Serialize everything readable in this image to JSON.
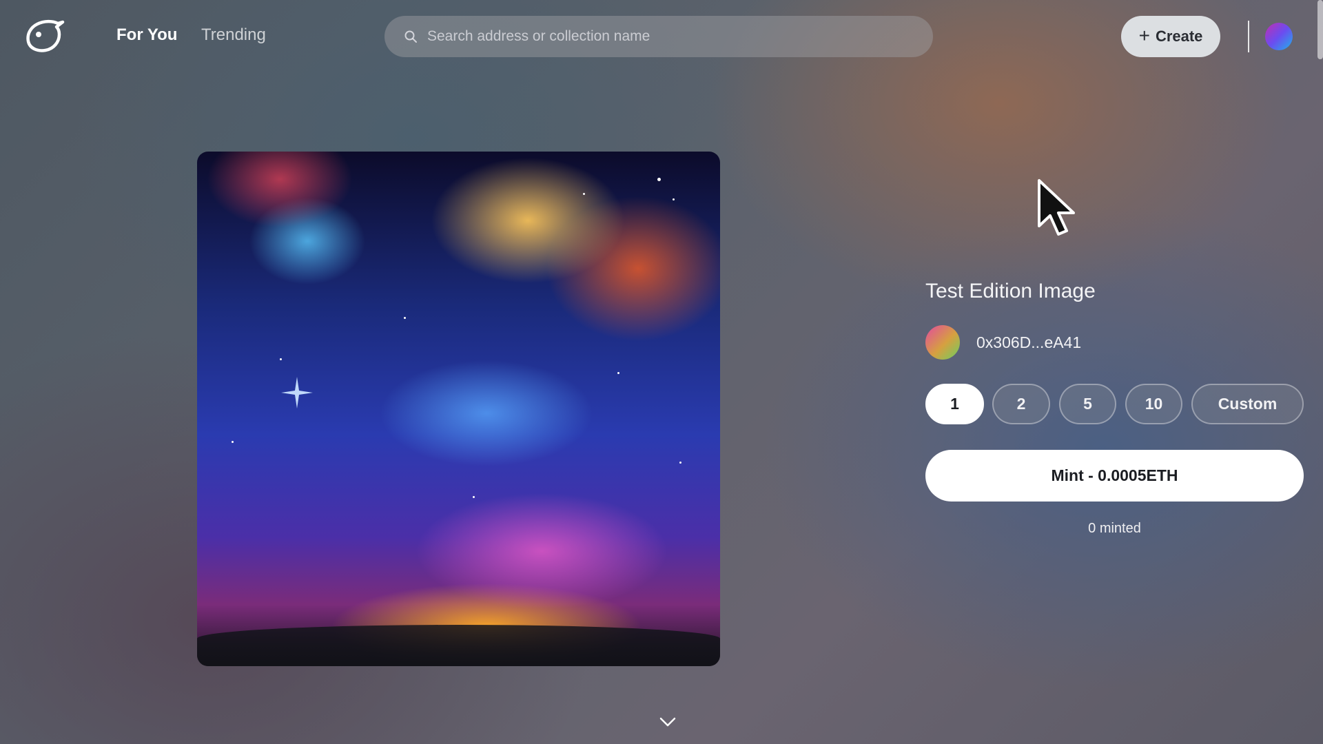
{
  "header": {
    "nav": {
      "for_you": "For You",
      "trending": "Trending"
    },
    "search": {
      "placeholder": "Search address or collection name",
      "value": ""
    },
    "create_label": "Create"
  },
  "edition": {
    "title": "Test Edition Image",
    "creator_address": "0x306D...eA41",
    "quantity_options": [
      "1",
      "2",
      "5",
      "10",
      "Custom"
    ],
    "selected_quantity": "1",
    "mint_label": "Mint - 0.0005ETH",
    "minted_status": "0 minted"
  },
  "icons": {
    "logo": "bird-logo-icon",
    "search": "search-icon",
    "create": "plus-icon",
    "scroll": "chevron-down-icon",
    "cursor": "mouse-pointer-icon"
  },
  "colors": {
    "mint_button_bg": "#ffffff",
    "selected_quantity_bg": "#ffffff",
    "create_button_bg": "#dcdfe2"
  }
}
